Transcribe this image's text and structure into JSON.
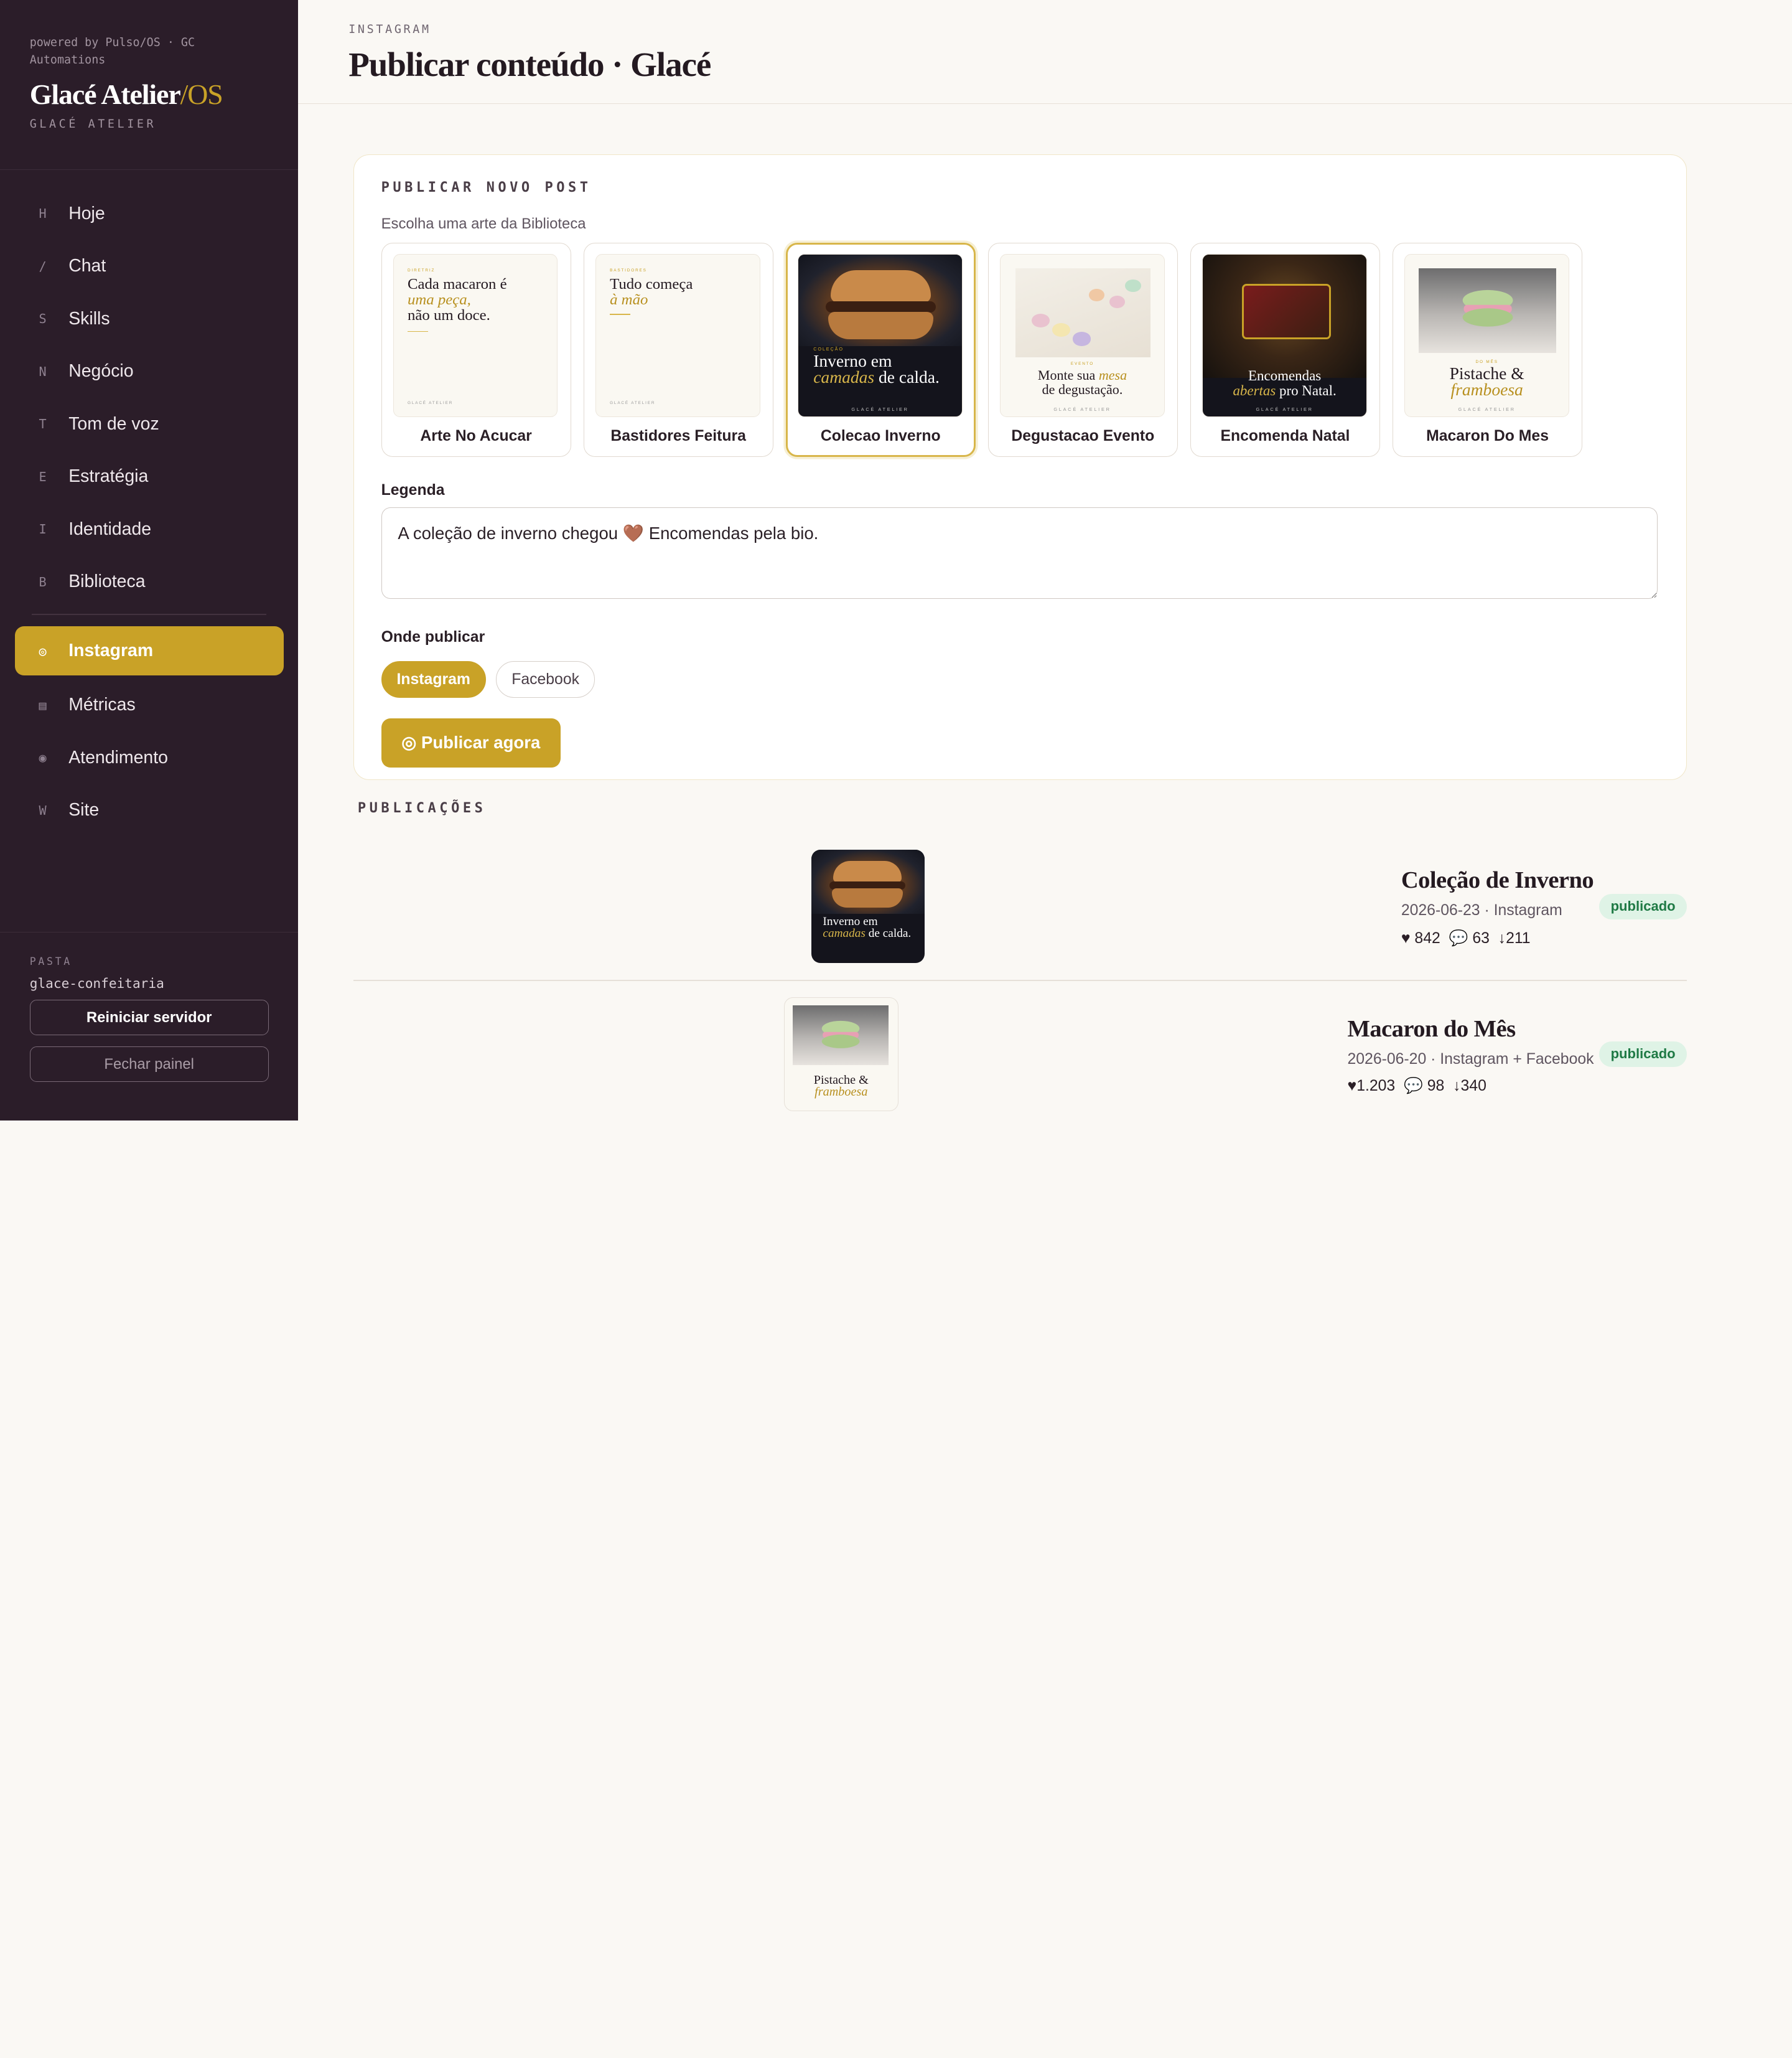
{
  "sidebar": {
    "powered_by": "powered by Pulso/OS · GC Automations",
    "brand_main": "Glacé Atelier",
    "brand_suffix": "/OS",
    "brand_sub": "GLACÉ ATELIER",
    "nav": [
      {
        "key": "H",
        "label": "Hoje"
      },
      {
        "key": "/",
        "label": "Chat"
      },
      {
        "key": "S",
        "label": "Skills"
      },
      {
        "key": "N",
        "label": "Negócio"
      },
      {
        "key": "T",
        "label": "Tom de voz"
      },
      {
        "key": "E",
        "label": "Estratégia"
      },
      {
        "key": "I",
        "label": "Identidade"
      },
      {
        "key": "B",
        "label": "Biblioteca"
      }
    ],
    "nav2": [
      {
        "key": "◎",
        "label": "Instagram",
        "active": true
      },
      {
        "key": "▤",
        "label": "Métricas"
      },
      {
        "key": "◉",
        "label": "Atendimento"
      },
      {
        "key": "W",
        "label": "Site"
      }
    ],
    "pasta_label": "PASTA",
    "pasta_value": "glace-confeitaria",
    "restart_label": "Reiniciar servidor",
    "close_label": "Fechar painel"
  },
  "header": {
    "eyebrow": "INSTAGRAM",
    "title": "Publicar conteúdo · Glacé"
  },
  "composer": {
    "section_label": "PUBLICAR NOVO POST",
    "choose_label": "Escolha uma arte da Biblioteca",
    "arts": [
      {
        "name": "Arte No Acucar",
        "eyebrow": "DIRETRIZ",
        "line1": "Cada macaron é",
        "line2": "uma peça,",
        "line3": "não um doce.",
        "footer": "GLACÉ ATELIER"
      },
      {
        "name": "Bastidores Feitura",
        "eyebrow": "BASTIDORES",
        "line1": "Tudo começa",
        "line2": "à mão",
        "footer": "GLACÉ ATELIER"
      },
      {
        "name": "Colecao Inverno",
        "eyebrow": "COLEÇÃO",
        "line1": "Inverno em",
        "line2": "camadas",
        "line3": "de calda.",
        "footer": "GLACÉ ATELIER",
        "selected": true
      },
      {
        "name": "Degustacao Evento",
        "eyebrow": "EVENTO",
        "line1": "Monte sua",
        "line2": "mesa",
        "line3": "de degustação.",
        "footer": "GLACÉ ATELIER"
      },
      {
        "name": "Encomenda Natal",
        "line1": "Encomendas",
        "line2": "abertas",
        "line3": "pro Natal.",
        "footer": "GLACÉ ATELIER"
      },
      {
        "name": "Macaron Do Mes",
        "eyebrow": "DO MÊS",
        "line1": "Pistache &",
        "line2": "framboesa",
        "footer": "GLACÉ ATELIER"
      }
    ],
    "caption_label": "Legenda",
    "caption_value": "A coleção de inverno chegou 🤎 Encomendas pela bio.",
    "where_label": "Onde publicar",
    "platforms": [
      {
        "label": "Instagram",
        "on": true
      },
      {
        "label": "Facebook",
        "on": false
      }
    ],
    "publish_label": "◎ Publicar agora"
  },
  "publications": {
    "label": "PUBLICAÇÕES",
    "items": [
      {
        "title": "Coleção de Inverno",
        "meta": "2026-06-23 · Instagram",
        "likes": "842",
        "comments": "63",
        "saves": "211",
        "status": "publicado"
      },
      {
        "title": "Macaron do Mês",
        "meta": "2026-06-20 · Instagram + Facebook",
        "likes": "1.203",
        "comments": "98",
        "saves": "340",
        "status": "publicado"
      }
    ]
  },
  "colors": {
    "accent": "#c9a227",
    "sidebar": "#2b1d29",
    "badge_bg": "#dff3e6",
    "badge_text": "#1f7a45"
  }
}
